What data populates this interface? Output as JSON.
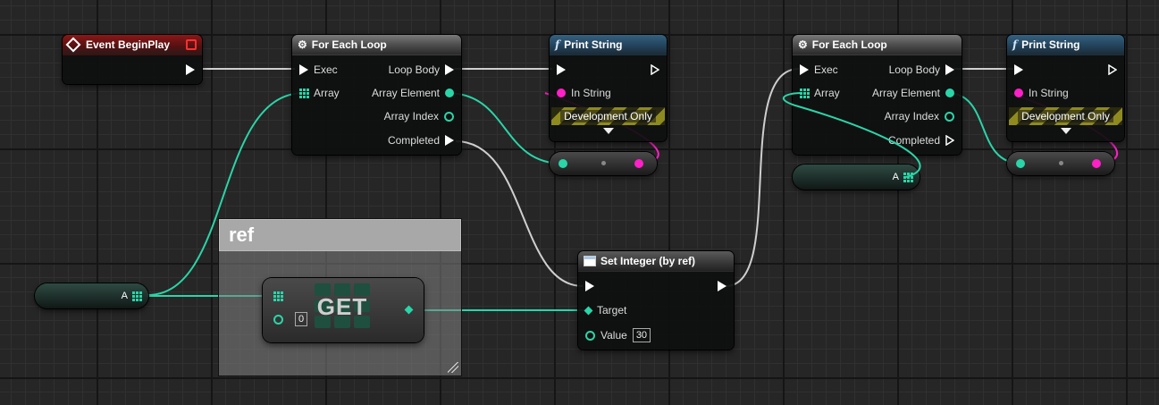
{
  "colors": {
    "exec": "#ffffff",
    "integer": "#2ad5a8",
    "string": "#ff20c8"
  },
  "event_begin_play": {
    "title": "Event BeginPlay",
    "icon": "diamond-event-icon"
  },
  "for_each_1": {
    "title": "For Each Loop",
    "icon": "macro-icon",
    "inputs": [
      "Exec",
      "Array"
    ],
    "outputs": [
      "Loop Body",
      "Array Element",
      "Array Index",
      "Completed"
    ]
  },
  "print_string_1": {
    "title": "Print String",
    "icon": "function-icon",
    "in_string": "In String",
    "dev_only": "Development Only"
  },
  "for_each_2": {
    "title": "For Each Loop",
    "icon": "macro-icon",
    "inputs": [
      "Exec",
      "Array"
    ],
    "outputs": [
      "Loop Body",
      "Array Element",
      "Array Index",
      "Completed"
    ]
  },
  "print_string_2": {
    "title": "Print String",
    "icon": "function-icon",
    "in_string": "In String",
    "dev_only": "Development Only"
  },
  "comment": {
    "title": "ref"
  },
  "get_node": {
    "label": "GET",
    "index": "0"
  },
  "set_integer": {
    "title": "Set Integer (by ref)",
    "target": "Target",
    "value_label": "Value",
    "value": "30"
  },
  "var_a_1": {
    "label": "A"
  },
  "var_a_2": {
    "label": "A"
  }
}
